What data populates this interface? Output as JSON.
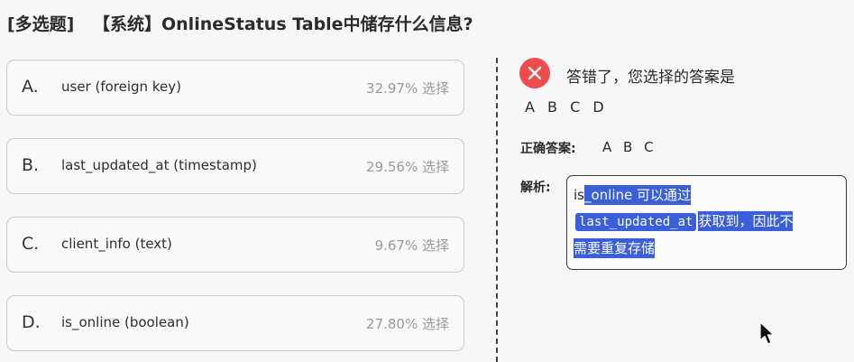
{
  "question": {
    "type_label": "[多选题]",
    "text": "【系统】OnlineStatus Table中储存什么信息?"
  },
  "options": [
    {
      "letter": "A.",
      "text": "user (foreign key)",
      "stat": "32.97% 选择"
    },
    {
      "letter": "B.",
      "text": "last_updated_at (timestamp)",
      "stat": "29.56% 选择"
    },
    {
      "letter": "C.",
      "text": "client_info (text)",
      "stat": "9.67% 选择"
    },
    {
      "letter": "D.",
      "text": "is_online (boolean)",
      "stat": "27.80% 选择"
    }
  ],
  "result": {
    "icon": "close-icon",
    "icon_color": "#ef4c4c",
    "message": "答错了，您选择的答案是",
    "selected": [
      "A",
      "B",
      "C",
      "D"
    ]
  },
  "correct": {
    "label": "正确答案:",
    "answers": [
      "A",
      "B",
      "C"
    ]
  },
  "explanation": {
    "label": "解析:",
    "prefix": "is",
    "part1": "_online 可以通过",
    "code": "last_updated_at",
    "part2": "获取到，因此不",
    "part3": "需要重复存储",
    "highlight_color": "#3b5fd9"
  }
}
